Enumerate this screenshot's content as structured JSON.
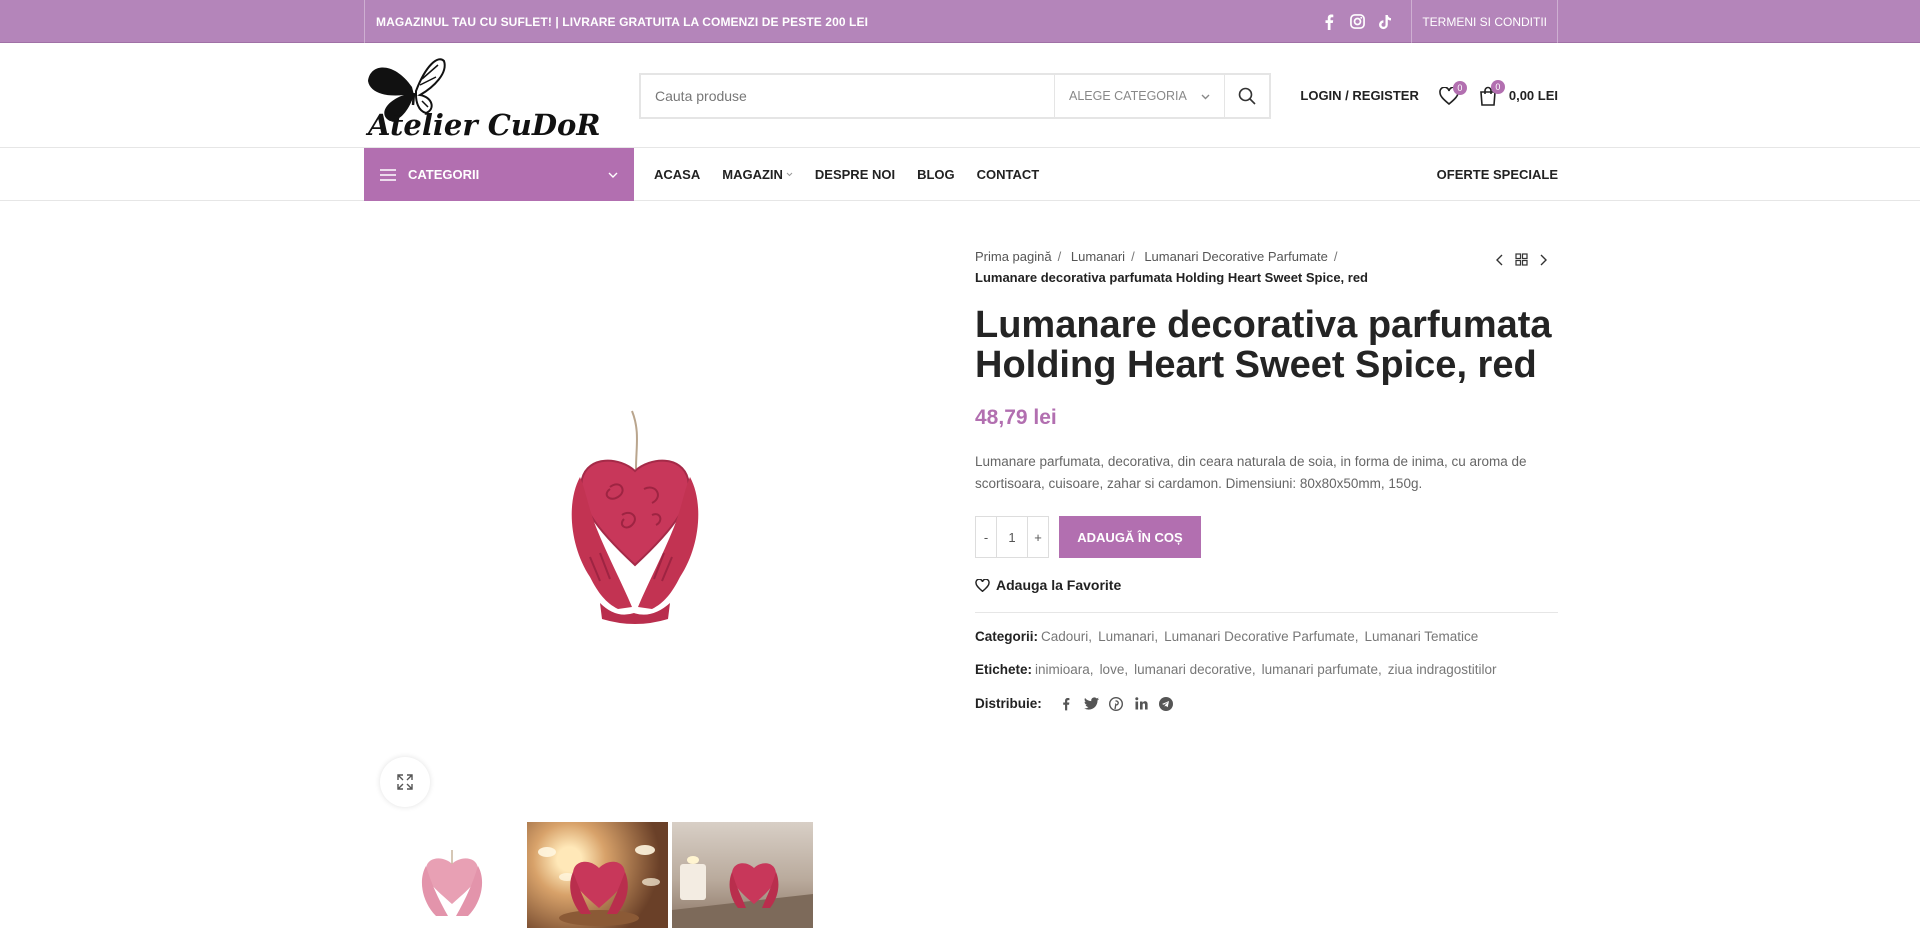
{
  "topbar": {
    "promo": "MAGAZINUL TAU CU SUFLET! | LIVRARE GRATUITA LA COMENZI DE PESTE 200 LEI",
    "terms": "TERMENI SI CONDITII",
    "social_icons": [
      "facebook-icon",
      "instagram-icon",
      "tiktok-icon"
    ]
  },
  "header": {
    "logo_text": "Atelier CuDoR",
    "search_placeholder": "Cauta produse",
    "category_select": "ALEGE CATEGORIA",
    "login": "LOGIN / REGISTER",
    "wishlist_count": "0",
    "cart_count": "0",
    "cart_total": "0,00 LEI"
  },
  "nav": {
    "categories_label": "CATEGORII",
    "items": [
      "ACASA",
      "MAGAZIN",
      "DESPRE NOI",
      "BLOG",
      "CONTACT"
    ],
    "special": "OFERTE SPECIALE"
  },
  "breadcrumbs": {
    "items": [
      "Prima pagină",
      "Lumanari",
      "Lumanari Decorative Parfumate"
    ],
    "current": "Lumanare decorativa parfumata Holding Heart Sweet Spice, red"
  },
  "product": {
    "title": "Lumanare decorativa parfumata Holding Heart Sweet Spice, red",
    "price": "48,79 lei",
    "description": "Lumanare parfumata, decorativa, din ceara naturala de soia, in forma de inima, cu aroma de scortisoara, cuisoare, zahar si cardamon. Dimensiuni:  80x80x50mm, 150g.",
    "quantity": "1",
    "minus": "-",
    "plus": "+",
    "add_to_cart": "ADAUGĂ ÎN COȘ",
    "wishlist": "Adauga la Favorite"
  },
  "meta": {
    "categories_label": "Categorii:",
    "categories": [
      "Cadouri",
      "Lumanari",
      "Lumanari Decorative Parfumate",
      "Lumanari Tematice"
    ],
    "tags_label": "Etichete:",
    "tags": [
      "inimioara",
      "love",
      "lumanari decorative",
      "lumanari parfumate",
      "ziua indragostitilor"
    ],
    "share_label": "Distribuie:",
    "share_icons": [
      "facebook-icon",
      "twitter-icon",
      "pinterest-icon",
      "linkedin-icon",
      "telegram-icon"
    ]
  },
  "colors": {
    "brand": "#b26fb0",
    "topbar": "#b485ba",
    "candle": "#c8375a"
  }
}
